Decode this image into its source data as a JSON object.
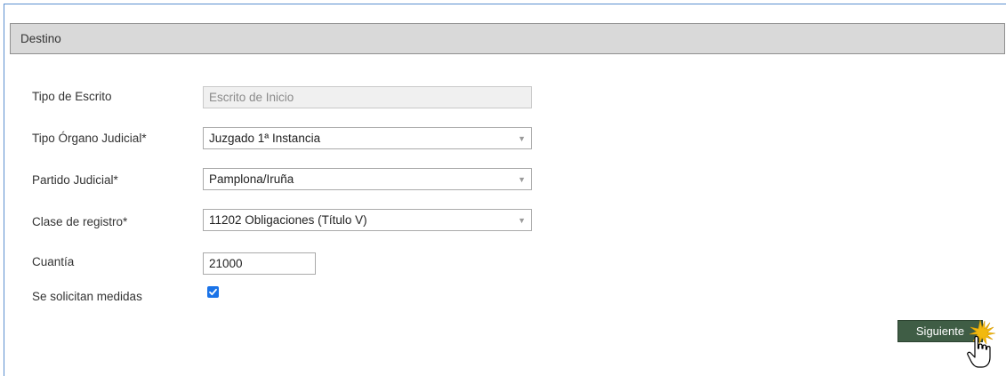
{
  "section": {
    "title": "Destino"
  },
  "form": {
    "tipo_escrito": {
      "label": "Tipo de Escrito",
      "value": "Escrito de Inicio"
    },
    "tipo_organo": {
      "label": "Tipo Órgano Judicial*",
      "value": "Juzgado 1ª Instancia"
    },
    "partido_judicial": {
      "label": "Partido Judicial*",
      "value": "Pamplona/Iruña"
    },
    "clase_registro": {
      "label": "Clase de registro*",
      "value": "11202 Obligaciones (Título V)"
    },
    "cuantia": {
      "label": "Cuantía",
      "value": "21000"
    },
    "medidas": {
      "label": "Se solicitan medidas",
      "checked": true
    }
  },
  "actions": {
    "next_label": "Siguiente"
  },
  "icons": {
    "dropdown": "chevron-down-icon",
    "checkbox": "check-icon",
    "cursor": "hand-pointer-icon"
  },
  "colors": {
    "header_bg": "#d9d9d9",
    "button_bg": "#3f5d45",
    "checkbox": "#1a73e8",
    "frame_border": "#5b8fcf"
  }
}
